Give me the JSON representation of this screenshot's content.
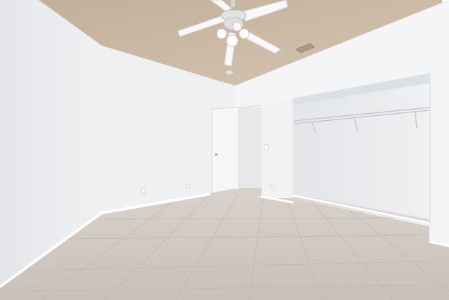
{
  "scene": {
    "kind": "photo",
    "subject": "empty-bedroom",
    "colors": {
      "ceiling": "#c9b7a0",
      "wall_left": "#eceef0",
      "wall_back": "#f2f3f4",
      "wall_right": "#f4f5f6",
      "closet_interior": "#e9ebed",
      "floor": "#cfc6bf",
      "floor_grout": "#bdb4ac",
      "baseboard": "#ffffff",
      "fan_blade": "#f7f7f7",
      "fan_body": "#d9d9d9",
      "door": "#f6f6f7",
      "vent": "#a99a86"
    },
    "objects": [
      "ceiling-fan-icon",
      "air-vent-icon",
      "smoke-detector-icon",
      "interior-door",
      "open-closet",
      "wire-shelf",
      "light-switch",
      "electrical-outlet",
      "tile-floor"
    ]
  }
}
